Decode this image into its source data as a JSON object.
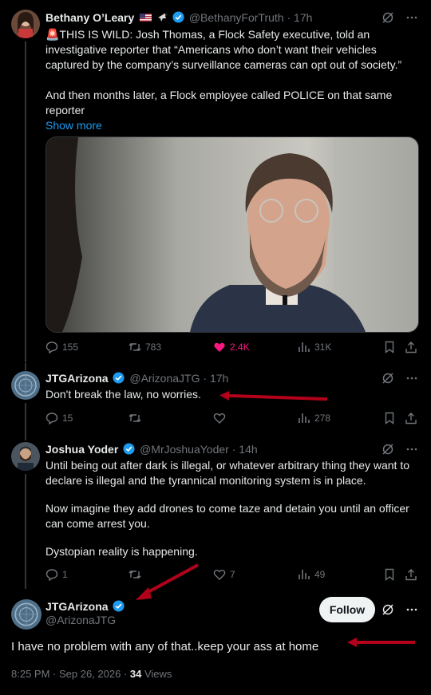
{
  "colors": {
    "background": "#000000",
    "text": "#e7e9ea",
    "muted": "#71767b",
    "link": "#1d9bf0",
    "like": "#f91880",
    "verified": "#1d9bf0",
    "annotation_arrow": "#b3001b"
  },
  "post1": {
    "author": "Bethany O’Leary",
    "emoji_badges": [
      "us-flag-icon",
      "eagle-icon"
    ],
    "handle": "@BethanyForTruth",
    "time": "17h",
    "body_line1": "🚨THIS IS WILD: Josh Thomas, a Flock Safety executive, told an investigative reporter that “Americans who don’t want their vehicles captured by the company’s surveillance cameras can opt out of society.”",
    "body_line2": "And then months later, a Flock employee called POLICE on that same reporter",
    "show_more": "Show more",
    "media": "video-frame-man-interview",
    "replies": "155",
    "reposts": "783",
    "likes": "2.4K",
    "views": "31K"
  },
  "reply1": {
    "author": "JTGArizona",
    "handle": "@ArizonaJTG",
    "time": "17h",
    "body": "Don't break the law, no worries.",
    "replies": "15",
    "reposts": "",
    "likes": "",
    "views": "278"
  },
  "reply2": {
    "author": "Joshua Yoder",
    "handle": "@MrJoshuaYoder",
    "time": "14h",
    "p1": "Until being out after dark is illegal, or whatever arbitrary thing they want to declare is illegal and the tyrannical monitoring system is in place.",
    "p2": "Now imagine they add drones to come taze and detain you until an officer can come arrest you.",
    "p3": "Dystopian reality is happening.",
    "replies": "1",
    "reposts": "",
    "likes": "7",
    "views": "49"
  },
  "main": {
    "author": "JTGArizona",
    "handle": "@ArizonaJTG",
    "follow_label": "Follow",
    "body": "I have no problem with any of that..keep your ass at home",
    "timestamp": "8:25 PM · Sep 26, 2026 · ",
    "views_count": "34",
    "views_label": " Views"
  }
}
